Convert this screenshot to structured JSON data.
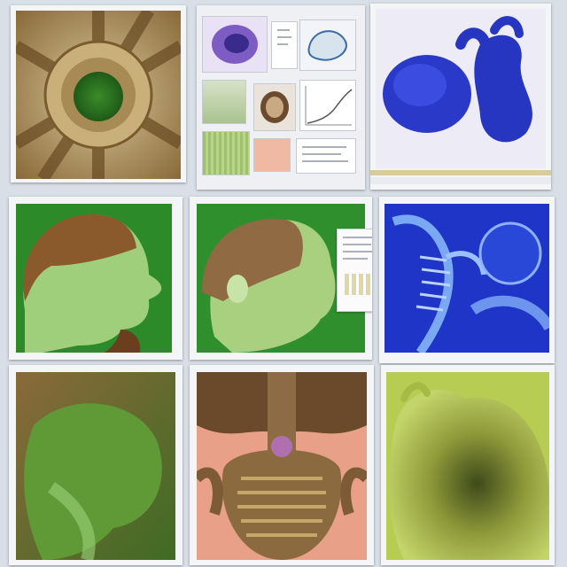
{
  "panels": [
    {
      "id": "p1",
      "subject": "radial-specimen-icon"
    },
    {
      "id": "p2",
      "subject": "lab-report-collage-icon"
    },
    {
      "id": "p3",
      "subject": "blue-organism-icon"
    },
    {
      "id": "p4",
      "subject": "head-profile-icon"
    },
    {
      "id": "p5",
      "subject": "head-with-note-icon"
    },
    {
      "id": "p6",
      "subject": "blue-skeleton-icon"
    },
    {
      "id": "p7",
      "subject": "green-tissue-icon"
    },
    {
      "id": "p8",
      "subject": "ribbed-torso-icon"
    },
    {
      "id": "p9",
      "subject": "textured-creature-icon"
    }
  ],
  "colors": {
    "background": "#d9dfe6",
    "frame": "#f4f5f7",
    "green": "#2f8a2a",
    "blue": "#2b3fd0",
    "tan": "#b08a55"
  }
}
